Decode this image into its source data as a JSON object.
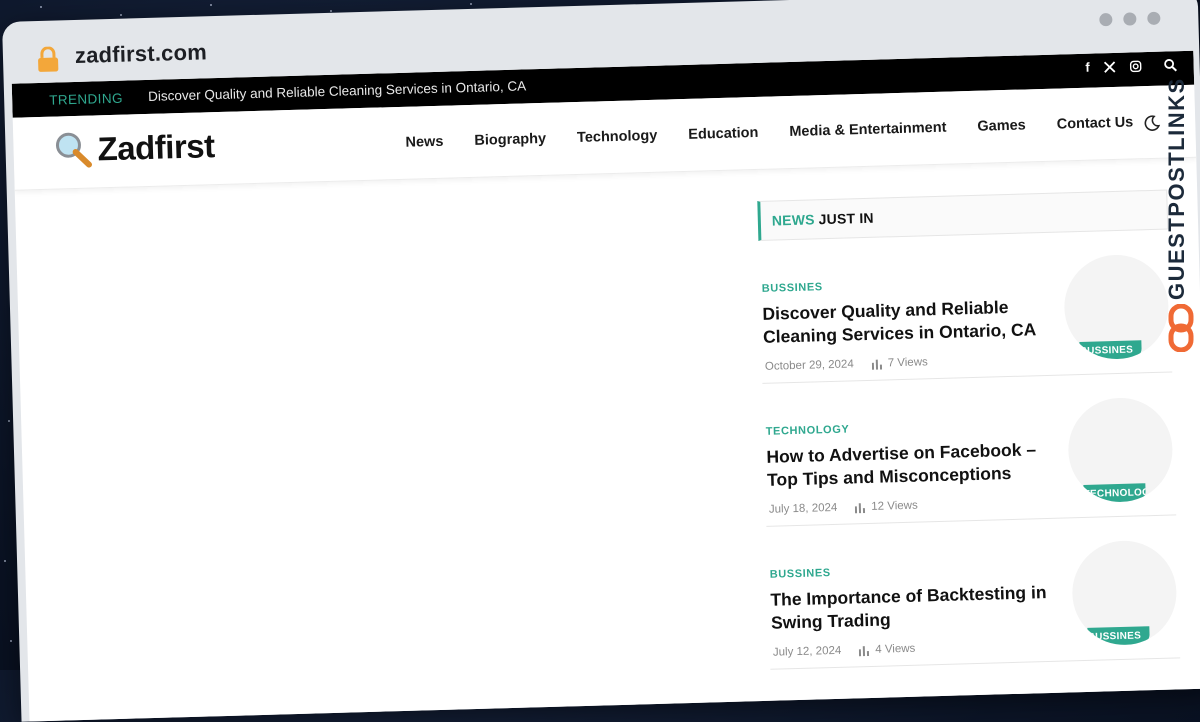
{
  "browser": {
    "url": "zadfirst.com"
  },
  "topbar": {
    "trending_label": "TRENDING",
    "trending_text": "Discover Quality and Reliable Cleaning Services in Ontario, CA",
    "social_icons": [
      "facebook-icon",
      "x-icon",
      "instagram-icon",
      "search-icon"
    ]
  },
  "header": {
    "logo_text": "Zadfirst",
    "nav": [
      "News",
      "Biography",
      "Technology",
      "Education",
      "Media & Entertainment",
      "Games",
      "Contact Us"
    ]
  },
  "sidebar": {
    "heading_accent": "NEWS",
    "heading_rest": "JUST IN",
    "posts": [
      {
        "category": "BUSSINES",
        "title": "Discover Quality and Reliable Cleaning Services in Ontario, CA",
        "date": "October 29, 2024",
        "views": "7 Views",
        "badge": "BUSSINES"
      },
      {
        "category": "TECHNOLOGY",
        "title": "How to Advertise on Facebook – Top Tips and Misconceptions",
        "date": "July 18, 2024",
        "views": "12 Views",
        "badge": "TECHNOLOGY"
      },
      {
        "category": "BUSSINES",
        "title": "The Importance of Backtesting in Swing Trading",
        "date": "July 12, 2024",
        "views": "4 Views",
        "badge": "BUSSINES"
      }
    ]
  },
  "watermark": {
    "text": "GUESTPOSTLINKS"
  },
  "colors": {
    "accent": "#2fa88f",
    "topbar_bg": "#000000",
    "watermark_orange": "#f06a35"
  }
}
